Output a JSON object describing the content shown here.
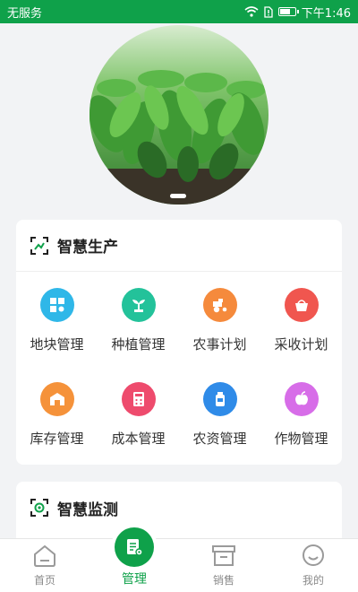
{
  "status_bar": {
    "carrier": "无服务",
    "time": "下午1:46"
  },
  "production": {
    "title": "智慧生产",
    "items": [
      {
        "label": "地块管理",
        "icon": "plot-grid-icon",
        "color": "#2fb7e8"
      },
      {
        "label": "种植管理",
        "icon": "seedling-icon",
        "color": "#23c29a"
      },
      {
        "label": "农事计划",
        "icon": "tractor-icon",
        "color": "#f58a3c"
      },
      {
        "label": "采收计划",
        "icon": "harvest-basket-icon",
        "color": "#f0564f"
      },
      {
        "label": "库存管理",
        "icon": "warehouse-icon",
        "color": "#f5923a"
      },
      {
        "label": "成本管理",
        "icon": "cost-calculator-icon",
        "color": "#ee4b6d"
      },
      {
        "label": "农资管理",
        "icon": "supplies-bottle-icon",
        "color": "#2f8be8"
      },
      {
        "label": "作物管理",
        "icon": "crop-apple-icon",
        "color": "#d76de8"
      }
    ]
  },
  "monitoring": {
    "title": "智慧监测"
  },
  "tabbar": {
    "tabs": [
      {
        "label": "首页"
      },
      {
        "label": "管理"
      },
      {
        "label": "销售"
      },
      {
        "label": "我的"
      }
    ],
    "active_color": "#0fa14a"
  }
}
